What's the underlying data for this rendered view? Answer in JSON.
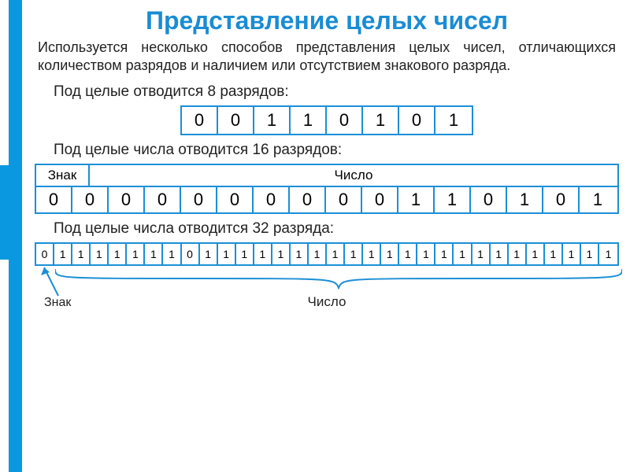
{
  "title": "Представление целых чисел",
  "intro": "Используется несколько способов представления целых чисел, отличающихся количеством разрядов и наличием или отсутствием знакового разряда.",
  "section8": "Под целые отводится 8 разрядов:",
  "bits8": [
    "0",
    "0",
    "1",
    "1",
    "0",
    "1",
    "0",
    "1"
  ],
  "section16": "Под целые числа отводится 16 разрядов:",
  "header16": {
    "sign": "Знак",
    "number": "Число"
  },
  "bits16": [
    "0",
    "0",
    "0",
    "0",
    "0",
    "0",
    "0",
    "0",
    "0",
    "0",
    "1",
    "1",
    "0",
    "1",
    "0",
    "1"
  ],
  "section32": "Под целые числа отводится 32 разряда:",
  "bits32": [
    "0",
    "1",
    "1",
    "1",
    "1",
    "1",
    "1",
    "1",
    "0",
    "1",
    "1",
    "1",
    "1",
    "1",
    "1",
    "1",
    "1",
    "1",
    "1",
    "1",
    "1",
    "1",
    "1",
    "1",
    "1",
    "1",
    "1",
    "1",
    "1",
    "1",
    "1",
    "1"
  ],
  "labels32": {
    "sign": "Знак",
    "number": "Число"
  }
}
